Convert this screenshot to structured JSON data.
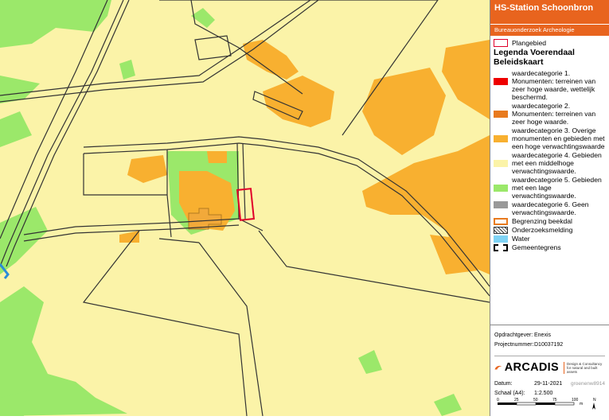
{
  "header": {
    "title": "HS-Station Schoonbron",
    "subtitle": "Bureauonderzoek Archeologie"
  },
  "legend": {
    "plangebied": "Plangebied",
    "title_line1": "Legenda Voerendaal",
    "title_line2": "Beleidskaart",
    "categories": [
      {
        "label": "waardecategorie 1. Monumenten: terreinen van zeer hoge waarde, wettelijk beschermd.",
        "color": "#ee0000"
      },
      {
        "label": "waardecategorie 2. Monumenten: terreinen van zeer hoge waarde.",
        "color": "#e87a1e"
      },
      {
        "label": "waardecategorie 3. Overige monumenten en gebieden met een hoge verwachtingswaarde",
        "color": "#f8b030"
      },
      {
        "label": "waardecategorie 4. Gebieden met een middelhoge verwachtingswaarde.",
        "color": "#fbf3a8"
      },
      {
        "label": "waardecategorie 5. Gebieden met een lage verwachtingswaarde.",
        "color": "#9be86a"
      },
      {
        "label": "waardecategorie 6. Geen verwachtingswaarde.",
        "color": "#999999"
      }
    ],
    "beekdal": "Begrenzing beekdal",
    "onderzoek": "Onderzoeksmelding",
    "water": "Water",
    "water_color": "#7fd3f5",
    "gemeentegrens": "Gemeentegrens"
  },
  "footer": {
    "opdrachtgever_label": "Opdrachtgever:",
    "opdrachtgever": "Enexis",
    "projectnummer_label": "Projectnummer:",
    "projectnummer": "D10037192",
    "company": "ARCADIS",
    "company_tag": "Design & Consultancy for natural and built assets",
    "datum_label": "Datum:",
    "datum": "29-11-2021",
    "author": "groenenw8914",
    "schaal_label": "Schaal (A4):",
    "schaal": "1:2.500",
    "scale_ticks": [
      "0",
      "25",
      "50",
      "75",
      "100"
    ],
    "scale_unit": "m",
    "north": "N"
  },
  "colors": {
    "accent": "#e8641e",
    "map_yellow": "#fbf3a8",
    "map_green": "#9be86a",
    "map_orange": "#f8b030"
  }
}
